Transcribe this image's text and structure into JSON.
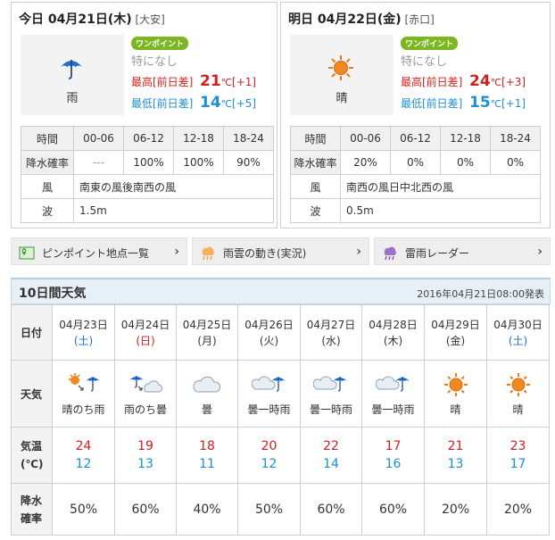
{
  "today": {
    "day_label": "今日 04月21日(木)",
    "place": "[大安]",
    "icon": "umbrella-icon",
    "weather": "雨",
    "onepoint": "ワンポイント",
    "onepoint_text": "特になし",
    "max_label": "最高[前日差]",
    "max_temp": "21",
    "max_diff": "[+1]",
    "min_label": "最低[前日差]",
    "min_temp": "14",
    "min_diff": "[+5]",
    "temp_unit": "℃",
    "table": {
      "time_label": "時間",
      "periods": [
        "00-06",
        "06-12",
        "12-18",
        "18-24"
      ],
      "rain_label": "降水確率",
      "rain": [
        "---",
        "100%",
        "100%",
        "90%"
      ],
      "wind_label": "風",
      "wind": "南東の風後南西の風",
      "wave_label": "波",
      "wave": "1.5m"
    }
  },
  "tomorrow": {
    "day_label": "明日 04月22日(金)",
    "place": "[赤口]",
    "icon": "sun-icon",
    "weather": "晴",
    "onepoint": "ワンポイント",
    "onepoint_text": "特になし",
    "max_label": "最高[前日差]",
    "max_temp": "24",
    "max_diff": "[+3]",
    "min_label": "最低[前日差]",
    "min_temp": "15",
    "min_diff": "[+1]",
    "temp_unit": "℃",
    "table": {
      "time_label": "時間",
      "periods": [
        "00-06",
        "06-12",
        "12-18",
        "18-24"
      ],
      "rain_label": "降水確率",
      "rain": [
        "20%",
        "0%",
        "0%",
        "0%"
      ],
      "wind_label": "風",
      "wind": "南西の風日中北西の風",
      "wave_label": "波",
      "wave": "0.5m"
    }
  },
  "nav": [
    {
      "label": "ピンポイント地点一覧",
      "icon": "pinpoint-map-icon",
      "icon_color": "#3a9a3a"
    },
    {
      "label": "雨雲の動き(実況)",
      "icon": "rain-cloud-icon",
      "icon_color": "#f0a040"
    },
    {
      "label": "雷雨レーダー",
      "icon": "thunder-radar-icon",
      "icon_color": "#8a4ab8"
    }
  ],
  "ten_day": {
    "title": "10日間天気",
    "issued": "2016年04月21日08:00発表",
    "labels": {
      "date": "日付",
      "weather": "天気",
      "temp_a": "気温",
      "temp_b": "(℃)",
      "rain_a": "降水",
      "rain_b": "確率"
    },
    "days": [
      {
        "date": "04月23日",
        "wd": "(土)",
        "wd_type": "sat",
        "icon": "sun-then-rain-icon",
        "weather": "晴のち雨",
        "max": "24",
        "min": "12",
        "rain": "50%"
      },
      {
        "date": "04月24日",
        "wd": "(日)",
        "wd_type": "sun",
        "icon": "rain-then-cloud-icon",
        "weather": "雨のち曇",
        "max": "19",
        "min": "13",
        "rain": "60%"
      },
      {
        "date": "04月25日",
        "wd": "(月)",
        "wd_type": "",
        "icon": "cloud-icon",
        "weather": "曇",
        "max": "18",
        "min": "11",
        "rain": "40%"
      },
      {
        "date": "04月26日",
        "wd": "(火)",
        "wd_type": "",
        "icon": "cloud-sometimes-rain-icon",
        "weather": "曇一時雨",
        "max": "20",
        "min": "12",
        "rain": "50%"
      },
      {
        "date": "04月27日",
        "wd": "(水)",
        "wd_type": "",
        "icon": "cloud-sometimes-rain-icon",
        "weather": "曇一時雨",
        "max": "22",
        "min": "14",
        "rain": "60%"
      },
      {
        "date": "04月28日",
        "wd": "(木)",
        "wd_type": "",
        "icon": "cloud-sometimes-rain-icon",
        "weather": "曇一時雨",
        "max": "17",
        "min": "16",
        "rain": "60%"
      },
      {
        "date": "04月29日",
        "wd": "(金)",
        "wd_type": "",
        "icon": "sun-icon",
        "weather": "晴",
        "max": "21",
        "min": "13",
        "rain": "20%"
      },
      {
        "date": "04月30日",
        "wd": "(土)",
        "wd_type": "sat",
        "icon": "sun-icon",
        "weather": "晴",
        "max": "23",
        "min": "17",
        "rain": "20%"
      }
    ]
  },
  "colors": {
    "max": "#d02020",
    "min": "#1e8fd2",
    "onepoint": "#7cb620",
    "sun": "#f07818",
    "rain": "#1e6fd0"
  }
}
